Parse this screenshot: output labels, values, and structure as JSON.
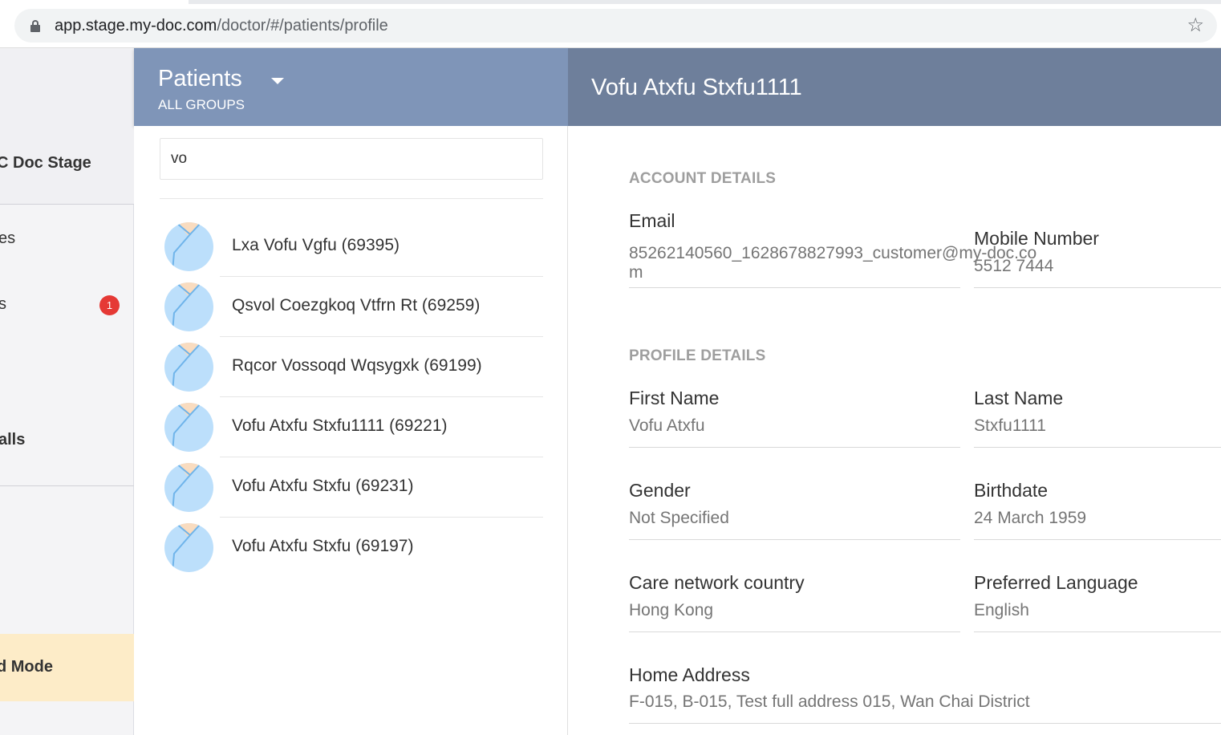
{
  "browser": {
    "url_host": "app.stage.my-doc.com",
    "url_path": "/doctor/#/patients/profile",
    "lock_icon": "lock-icon",
    "star_icon": "star-icon"
  },
  "leftnav": {
    "brand": "C Doc Stage",
    "items": [
      {
        "label": "es"
      },
      {
        "label": "s",
        "badge": "1"
      },
      {
        "label": "alls"
      }
    ],
    "mode_label": "d Mode"
  },
  "patients": {
    "title": "Patients",
    "subtitle": "ALL GROUPS",
    "search_value": "vo",
    "list": [
      {
        "name": "Lxa Vofu Vgfu (69395)"
      },
      {
        "name": "Qsvol Coezgkoq Vtfrn Rt (69259)"
      },
      {
        "name": "Rqcor Vossoqd Wqsygxk (69199)"
      },
      {
        "name": "Vofu Atxfu Stxfu1111 (69221)"
      },
      {
        "name": "Vofu Atxfu Stxfu (69231)"
      },
      {
        "name": "Vofu Atxfu Stxfu (69197)"
      }
    ]
  },
  "detail": {
    "title": "Vofu Atxfu Stxfu1111",
    "account_section": "ACCOUNT DETAILS",
    "email_label": "Email",
    "email_value": "85262140560_1628678827993_customer@my-doc.com",
    "mobile_label": "Mobile Number",
    "mobile_value": "5512 7444",
    "profile_section": "PROFILE DETAILS",
    "first_name_label": "First Name",
    "first_name_value": "Vofu Atxfu",
    "last_name_label": "Last Name",
    "last_name_value": "Stxfu1111",
    "gender_label": "Gender",
    "gender_value": "Not Specified",
    "birthdate_label": "Birthdate",
    "birthdate_value": "24 March 1959",
    "country_label": "Care network country",
    "country_value": "Hong Kong",
    "language_label": "Preferred Language",
    "language_value": "English",
    "address_label": "Home Address",
    "address_value": "F-015, B-015, Test full address 015, Wan Chai District"
  },
  "colors": {
    "patients_header": "#7f95b8",
    "detail_header": "#6e7f9b",
    "badge": "#e53935",
    "mode_strip": "#fdecc8",
    "avatar_bg": "#bcdffb"
  }
}
